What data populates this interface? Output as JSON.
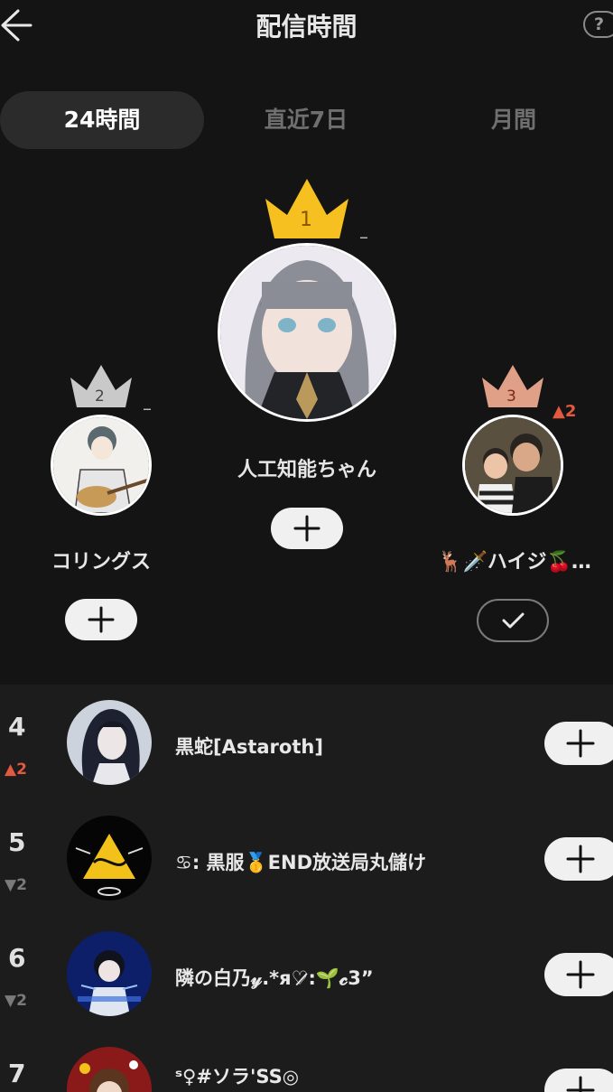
{
  "header": {
    "title": "配信時間",
    "help_label": "?"
  },
  "tabs": [
    {
      "label": "24時間",
      "active": true
    },
    {
      "label": "直近7日",
      "active": false
    },
    {
      "label": "月間",
      "active": false
    }
  ],
  "podium": [
    {
      "rank": "2",
      "name": "コリングス",
      "change": "–",
      "change_dir": "none",
      "followed": false,
      "crown_color": "silver"
    },
    {
      "rank": "1",
      "name": "人工知能ちゃん",
      "change": "–",
      "change_dir": "none",
      "followed": false,
      "crown_color": "gold"
    },
    {
      "rank": "3",
      "name": "🦌🗡️ハイジ🍒…",
      "change": "▲2",
      "change_dir": "up",
      "followed": true,
      "crown_color": "bronze"
    }
  ],
  "ranking_list": [
    {
      "rank": "4",
      "change": "▲2",
      "change_dir": "up",
      "name": "黒蛇[Astaroth]"
    },
    {
      "rank": "5",
      "change": "▼2",
      "change_dir": "down",
      "name": "♋︎: 黒服🥇END放送局丸儲け"
    },
    {
      "rank": "6",
      "change": "▼2",
      "change_dir": "down",
      "name": "隣の白乃𝓎.*я♡̷̷:🌱𝓬3”"
    },
    {
      "rank": "7",
      "change": "",
      "change_dir": "none",
      "name": "ˢ♀#ソラ'SS◎"
    }
  ],
  "colors": {
    "background": "#141414",
    "list_background": "#1c1c1c",
    "gold": "#f5c020",
    "silver": "#c9c9c9",
    "bronze": "#e0a088",
    "up": "#e2593f",
    "down": "#7a7a7a"
  },
  "icons": {
    "back": "arrow-left-icon",
    "help": "question-icon",
    "follow": "plus-icon",
    "following": "check-icon"
  }
}
